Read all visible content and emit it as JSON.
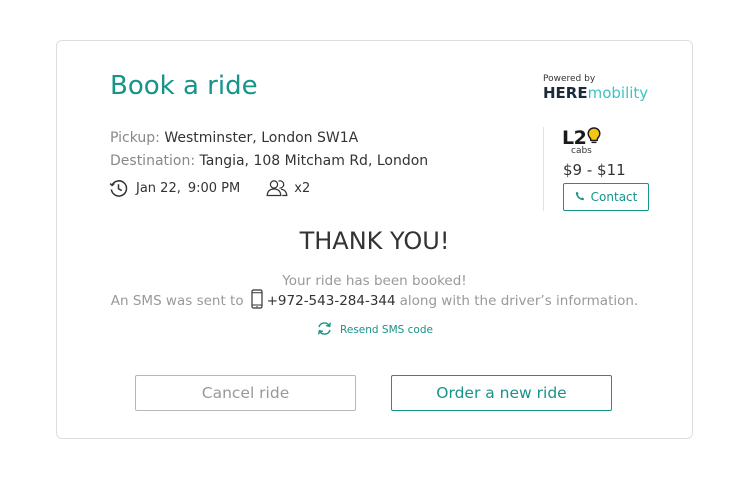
{
  "card": {
    "title": "Book a ride",
    "powered_by": "Powered by",
    "brand_part1": "HERE",
    "brand_part2": "mobility"
  },
  "trip": {
    "pickup_label": "Pickup:",
    "pickup_value": "Westminster, London SW1A",
    "destination_label": "Destination:",
    "destination_value": "Tangia, 108 Mitcham Rd, London",
    "date": "Jan 22,",
    "time": "9:00 PM",
    "passengers": "x2"
  },
  "provider": {
    "logo_text": "L2",
    "logo_sub": "cabs",
    "price": "$9 - $11",
    "contact_label": "Contact"
  },
  "confirmation": {
    "heading": "THANK YOU!",
    "booked_text": "Your ride has been booked!",
    "sms_prefix": "An SMS was sent to",
    "phone_number": "+972-543-284-344",
    "sms_suffix": "along with the driver’s information.",
    "resend_label": "Resend SMS code"
  },
  "actions": {
    "cancel_label": "Cancel ride",
    "order_label": "Order a new ride"
  },
  "colors": {
    "accent": "#17948a",
    "brand_light": "#3ec3c4",
    "logo_bulb": "#f5c518"
  },
  "icons": [
    "clock-icon",
    "people-icon",
    "phone-icon",
    "mobile-phone-icon",
    "refresh-icon",
    "lightbulb-icon"
  ]
}
